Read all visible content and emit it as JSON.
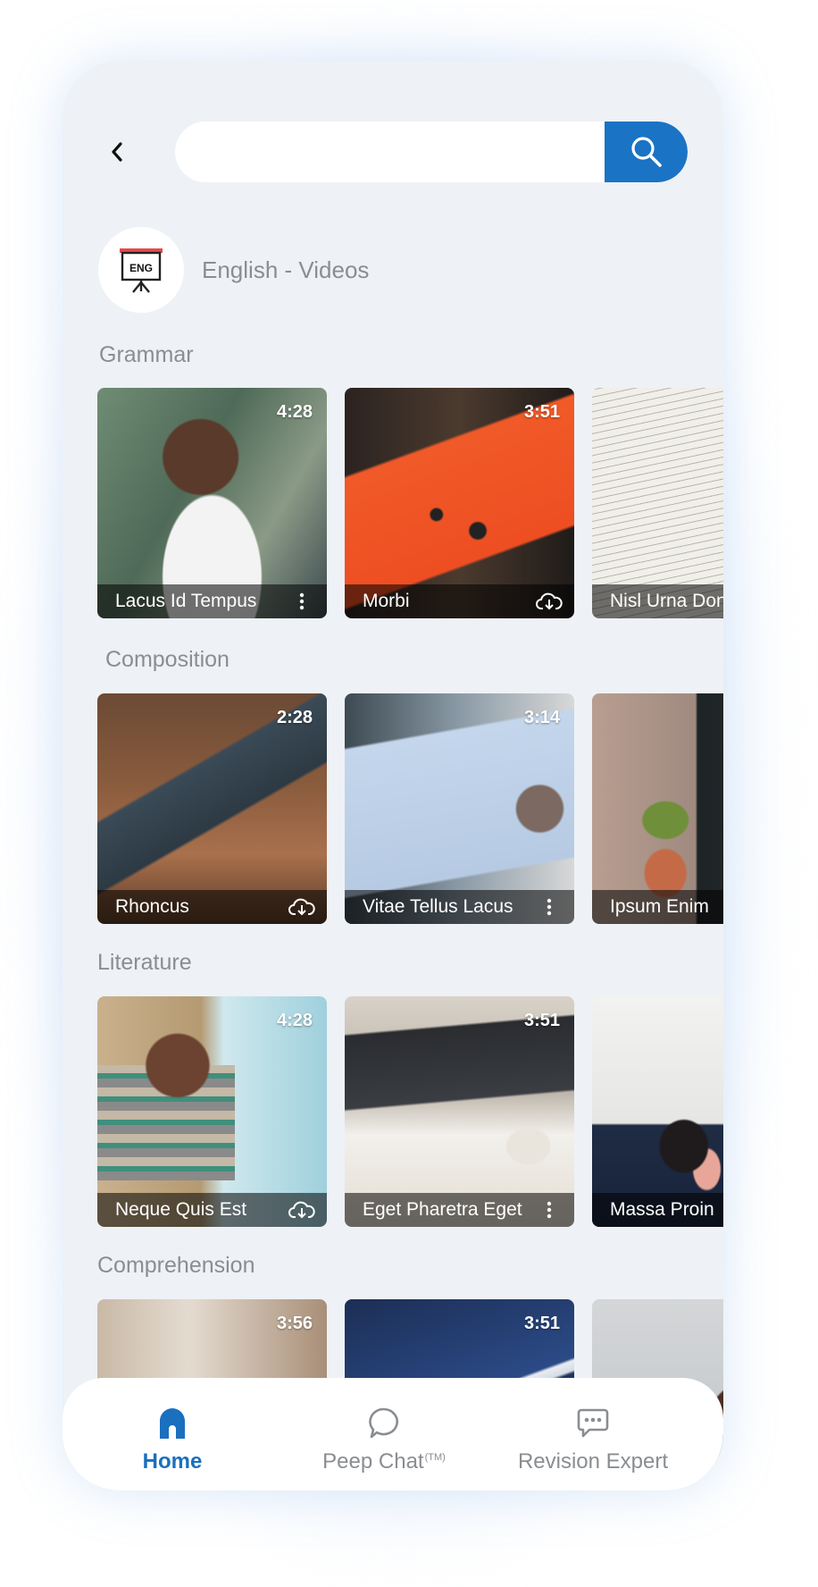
{
  "search": {
    "placeholder": "",
    "value": ""
  },
  "subject": {
    "title": "English - Videos",
    "badge_text": "ENG"
  },
  "sections": [
    {
      "title": "Grammar",
      "cards": [
        {
          "title": "Lacus Id Tempus",
          "duration": "4:28",
          "action": "more-options"
        },
        {
          "title": "Morbi",
          "duration": "3:51",
          "action": "download"
        },
        {
          "title": "Nisl Urna Donec",
          "duration": "",
          "action": ""
        }
      ]
    },
    {
      "title": "Composition",
      "cards": [
        {
          "title": "Rhoncus",
          "duration": "2:28",
          "action": "download"
        },
        {
          "title": "Vitae Tellus Lacus",
          "duration": "3:14",
          "action": "more-options"
        },
        {
          "title": "Ipsum Enim",
          "duration": "",
          "action": ""
        }
      ]
    },
    {
      "title": "Literature",
      "cards": [
        {
          "title": "Neque Quis Est",
          "duration": "4:28",
          "action": "download"
        },
        {
          "title": "Eget Pharetra Eget",
          "duration": "3:51",
          "action": "more-options"
        },
        {
          "title": "Massa Proin",
          "duration": "",
          "action": ""
        }
      ]
    },
    {
      "title": "Comprehension",
      "cards": [
        {
          "title": "",
          "duration": "3:56",
          "action": ""
        },
        {
          "title": "",
          "duration": "3:51",
          "action": ""
        },
        {
          "title": "",
          "duration": "",
          "action": ""
        }
      ]
    }
  ],
  "nav": {
    "home": "Home",
    "peep_chat": "Peep Chat",
    "peep_chat_mark": "(TM)",
    "revision_expert": "Revision Expert"
  },
  "colors": {
    "accent": "#1a73c4",
    "background": "#eef1f5",
    "muted_text": "#8a8d91"
  }
}
